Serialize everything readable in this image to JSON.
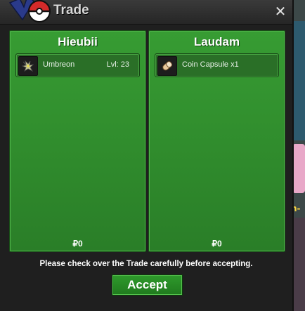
{
  "window": {
    "title": "Trade",
    "close_glyph": "✕"
  },
  "left_panel": {
    "player": "Hieubii",
    "item": {
      "icon": "umbreon-sprite-icon",
      "name": "Umbreon",
      "level": "Lvl: 23"
    },
    "money": "₽0"
  },
  "right_panel": {
    "player": "Laudam",
    "item": {
      "icon": "coin-capsule-icon",
      "name": "Coin Capsule x1"
    },
    "money": "₽0"
  },
  "footer": {
    "notice": "Please check over the Trade carefully before accepting.",
    "accept_label": "Accept"
  },
  "scene": {
    "visible_text": "n-"
  },
  "colors": {
    "panel_green": "#379c33",
    "accept_green": "#2f9a2c",
    "window_bg": "#1f1f1f"
  }
}
